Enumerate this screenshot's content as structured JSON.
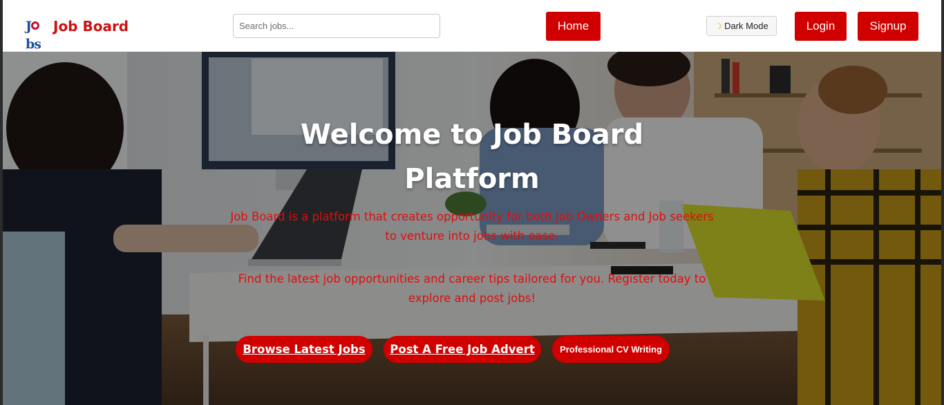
{
  "nav": {
    "brand": "Job Board",
    "logo_text_left": "J",
    "logo_text_right": "bs",
    "search_placeholder": "Search jobs...",
    "home": "Home",
    "dark_mode_icon": "moon-icon",
    "dark_mode": "Dark Mode",
    "login": "Login",
    "signup": "Signup"
  },
  "hero": {
    "title_line1": "Welcome to Job Board",
    "title_line2": "Platform",
    "paragraph1": "Job Board is a platform that creates opportunity for both Job Owners and Job seekers to venture into jobs with ease.",
    "paragraph2": "Find the latest job opportunities and career tips tailored for you. Register today to explore and post jobs!",
    "buttons": {
      "browse": "Browse Latest Jobs",
      "post": "Post A Free Job Advert",
      "cv": "Professional CV Writing"
    }
  },
  "colors": {
    "brand_red": "#d10000",
    "paragraph_red": "#e00d0d",
    "logo_blue": "#1e4f9c"
  }
}
